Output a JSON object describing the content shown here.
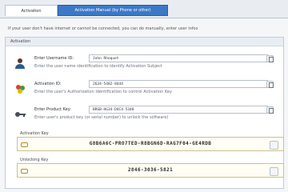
{
  "tabs": [
    {
      "label": "Activation"
    },
    {
      "label": "Activation Manual (by Phone or other)"
    }
  ],
  "info_text": "If your user don't have internet or cannot be connected, you can do manually, enter user infos",
  "panel": {
    "title": "Activation"
  },
  "fields": [
    {
      "label": "Enter Username ID:",
      "value": "John Rhoquet",
      "hint": "Enter the user name identification to identify Activation Subject",
      "icon": "user-icon"
    },
    {
      "label": "Activation ID:",
      "value": "2634-5482-8444",
      "hint": "Enter the user's Authorization Identification to control Activation Key",
      "icon": "activation-id-icon"
    },
    {
      "label": "Enter Product Key:",
      "value": "BRSB-HG34-D4C4-5348",
      "hint": "Enter user's product key (or serial number) to unlock the software)",
      "icon": "product-key-icon"
    }
  ],
  "activation_key": {
    "title": "Activation Key",
    "value": "G8B6A6C-PRO7TED-R8BGN6D-RAG7F04-GE4RDB",
    "icon": "key-icon"
  },
  "unlock_key": {
    "title": "Unlocking Key",
    "value": "2846-3036-5821",
    "icon": "unlock-key-icon"
  }
}
